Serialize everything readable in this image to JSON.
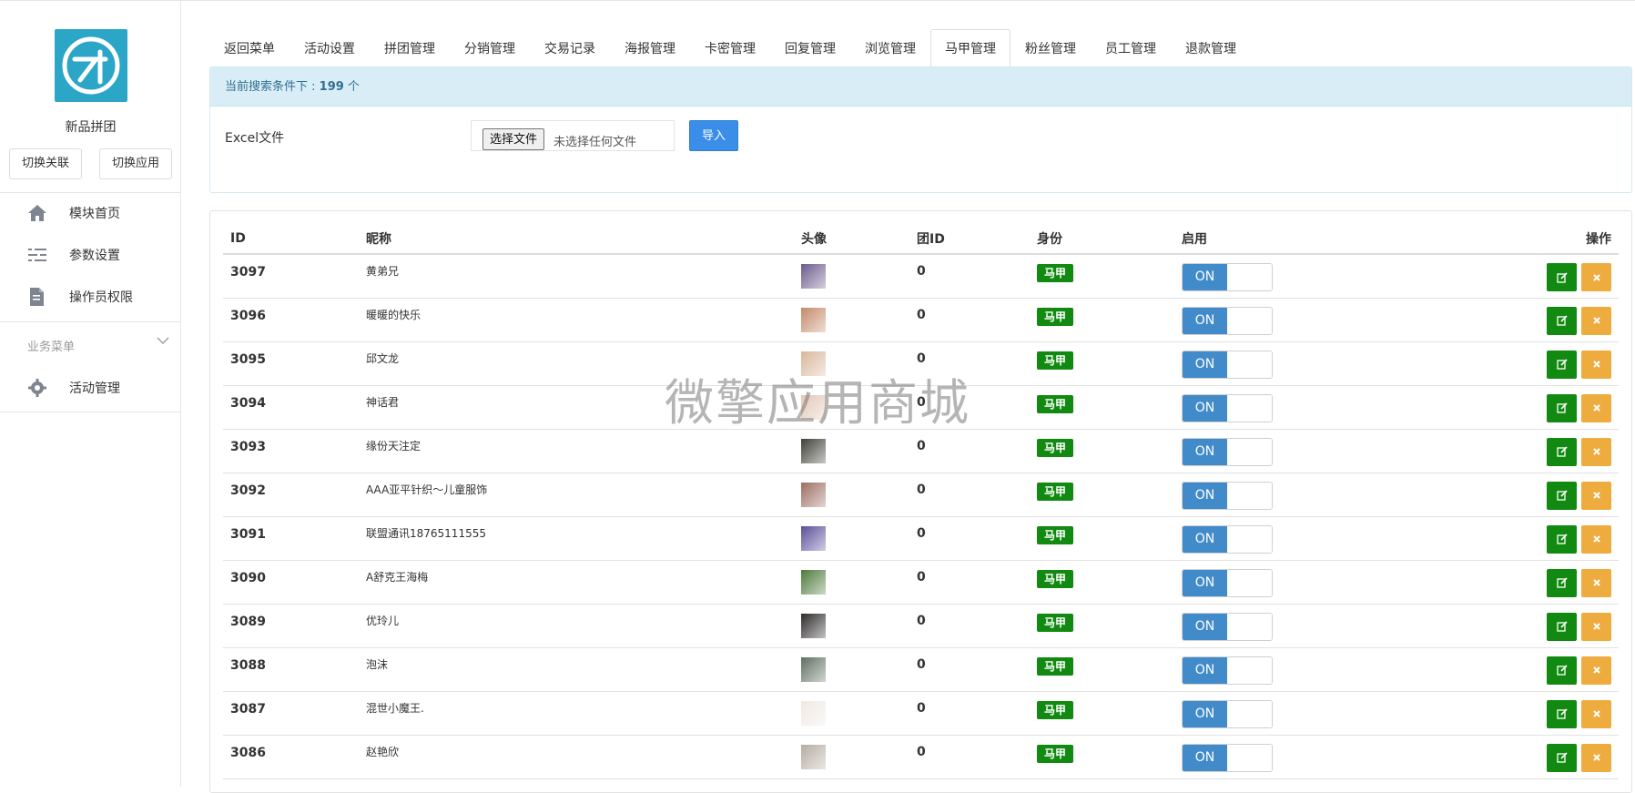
{
  "sidebar": {
    "app_name": "新品拼团",
    "switch_link_label": "切换关联",
    "switch_app_label": "切换应用",
    "nav": [
      {
        "label": "模块首页",
        "icon": "home-icon"
      },
      {
        "label": "参数设置",
        "icon": "sliders-icon"
      },
      {
        "label": "操作员权限",
        "icon": "document-icon"
      }
    ],
    "section_label": "业务菜单",
    "business_nav": [
      {
        "label": "活动管理",
        "icon": "gear-icon"
      }
    ]
  },
  "tabs": [
    {
      "label": "返回菜单"
    },
    {
      "label": "活动设置"
    },
    {
      "label": "拼团管理"
    },
    {
      "label": "分销管理"
    },
    {
      "label": "交易记录"
    },
    {
      "label": "海报管理"
    },
    {
      "label": "卡密管理"
    },
    {
      "label": "回复管理"
    },
    {
      "label": "浏览管理"
    },
    {
      "label": "马甲管理"
    },
    {
      "label": "粉丝管理"
    },
    {
      "label": "员工管理"
    },
    {
      "label": "退款管理"
    }
  ],
  "active_tab": "马甲管理",
  "search_info": {
    "prefix": "当前搜索条件下 : ",
    "count": "199",
    "suffix": " 个"
  },
  "import": {
    "label": "Excel文件",
    "file_button": "选择文件",
    "file_status": "未选择任何文件",
    "import_button": "导入"
  },
  "table": {
    "headers": {
      "id": "ID",
      "nickname": "昵称",
      "avatar": "头像",
      "group_id": "团ID",
      "identity": "身份",
      "enabled": "启用",
      "actions": "操作"
    },
    "rows": [
      {
        "id": "3097",
        "nickname": "黄弟兄",
        "group_id": "0",
        "identity": "马甲",
        "enabled": "ON",
        "avatar_color": "#6b5a8c"
      },
      {
        "id": "3096",
        "nickname": "暖暖的快乐",
        "group_id": "0",
        "identity": "马甲",
        "enabled": "ON",
        "avatar_color": "#c48a6a"
      },
      {
        "id": "3095",
        "nickname": "邱文龙",
        "group_id": "0",
        "identity": "马甲",
        "enabled": "ON",
        "avatar_color": "#d9b79a"
      },
      {
        "id": "3094",
        "nickname": "神话君",
        "group_id": "0",
        "identity": "马甲",
        "enabled": "ON",
        "avatar_color": "#e4c7b5"
      },
      {
        "id": "3093",
        "nickname": "缘份天注定",
        "group_id": "0",
        "identity": "马甲",
        "enabled": "ON",
        "avatar_color": "#3f4038"
      },
      {
        "id": "3092",
        "nickname": "AAA亚平针织～儿童服饰",
        "group_id": "0",
        "identity": "马甲",
        "enabled": "ON",
        "avatar_color": "#9c6d62"
      },
      {
        "id": "3091",
        "nickname": "联盟通讯18765111555",
        "group_id": "0",
        "identity": "马甲",
        "enabled": "ON",
        "avatar_color": "#5a4f9a"
      },
      {
        "id": "3090",
        "nickname": "A舒克王海梅",
        "group_id": "0",
        "identity": "马甲",
        "enabled": "ON",
        "avatar_color": "#4c7a3a"
      },
      {
        "id": "3089",
        "nickname": "优玲儿",
        "group_id": "0",
        "identity": "马甲",
        "enabled": "ON",
        "avatar_color": "#2e2a2a"
      },
      {
        "id": "3088",
        "nickname": "泡沫",
        "group_id": "0",
        "identity": "马甲",
        "enabled": "ON",
        "avatar_color": "#5e7060"
      },
      {
        "id": "3087",
        "nickname": "混世小魔王.",
        "group_id": "0",
        "identity": "马甲",
        "enabled": "ON",
        "avatar_color": "#efe9e2"
      },
      {
        "id": "3086",
        "nickname": "赵艳欣",
        "group_id": "0",
        "identity": "马甲",
        "enabled": "ON",
        "avatar_color": "#b6aca0"
      }
    ]
  },
  "watermark": "微擎应用商城",
  "colors": {
    "accent_blue": "#428bca",
    "import_blue": "#3b8ee8",
    "success_green": "#128a12",
    "warning_orange": "#efac3e",
    "info_bg": "#d9edf7",
    "logo_teal": "#2ba6c7"
  }
}
